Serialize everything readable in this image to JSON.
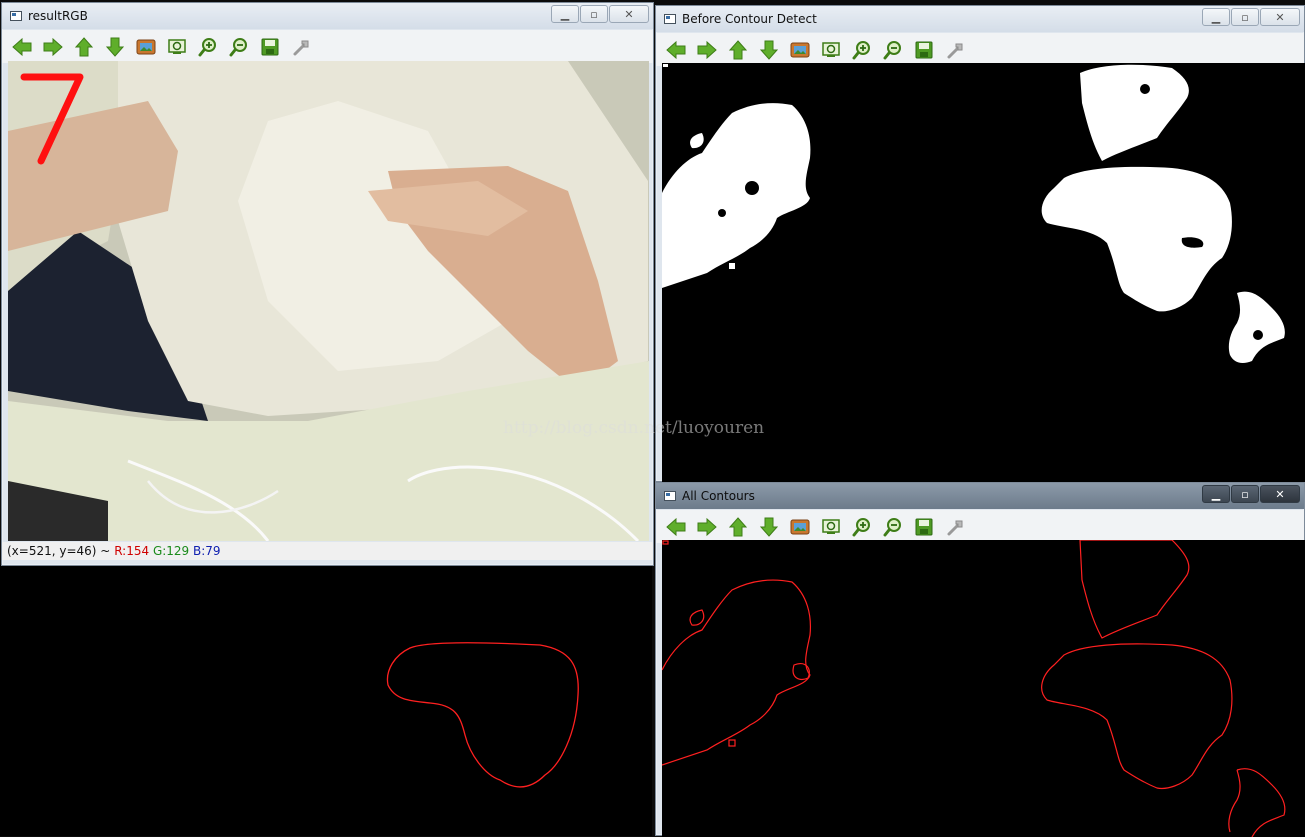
{
  "windows": {
    "result": {
      "title": "resultRGB"
    },
    "before": {
      "title": "Before Contour Detect"
    },
    "contours": {
      "title": "All Contours"
    }
  },
  "toolbar_icons": [
    "arrow-left-icon",
    "arrow-right-icon",
    "arrow-up-icon",
    "arrow-down-icon",
    "image-icon",
    "zoom-fit-icon",
    "zoom-in-icon",
    "zoom-out-icon",
    "save-icon",
    "properties-icon"
  ],
  "status": {
    "coords": "(x=521, y=46) ~",
    "r": "R:154",
    "g": "G:129",
    "b": "B:79"
  },
  "overlay_digit": "7",
  "watermark": "http://blog.csdn.net/luoyouren",
  "colors": {
    "contour": "#ff2020",
    "digit": "#ff1010"
  }
}
